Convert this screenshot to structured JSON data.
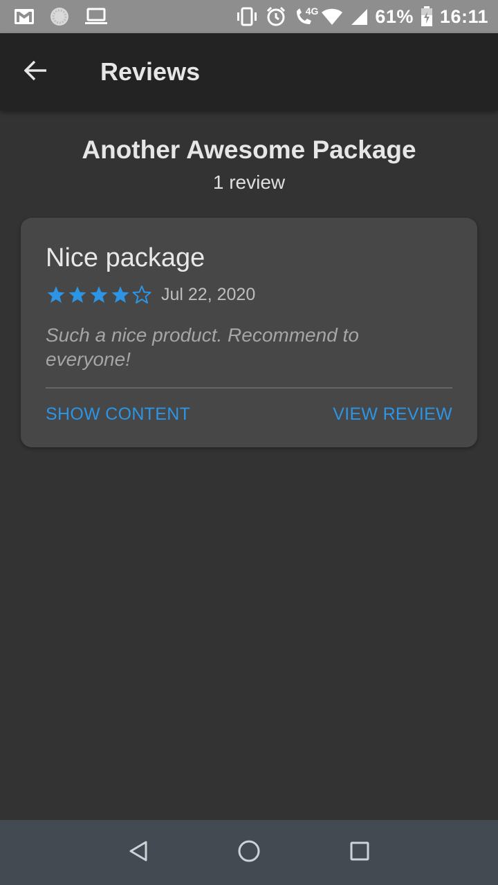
{
  "status_bar": {
    "icons_left": [
      "gmail-icon",
      "sync-icon",
      "laptop-icon"
    ],
    "icons_right": [
      "vibrate-icon",
      "alarm-icon",
      "volte-call-icon",
      "wifi-icon",
      "signal-icon"
    ],
    "network_tag": "4G",
    "battery_percent": "61%",
    "time": "16:11"
  },
  "app_bar": {
    "title": "Reviews",
    "back_icon": "arrow-back-icon"
  },
  "package": {
    "name": "Another Awesome Package",
    "review_count": "1 review"
  },
  "reviews": [
    {
      "title": "Nice package",
      "rating": 4,
      "max_rating": 5,
      "date": "Jul 22, 2020",
      "body": "Such a nice product. Recommend to everyone!",
      "actions": {
        "show_content": "SHOW CONTENT",
        "view_review": "VIEW REVIEW"
      }
    }
  ],
  "colors": {
    "accent": "#2c95e6",
    "background": "#333333",
    "card": "#474747",
    "app_bar": "#232323",
    "status_bar": "#8e8e8e",
    "nav_bar": "#434a52"
  },
  "nav_bar": {
    "icons": [
      "nav-back-icon",
      "nav-home-icon",
      "nav-recents-icon"
    ]
  }
}
